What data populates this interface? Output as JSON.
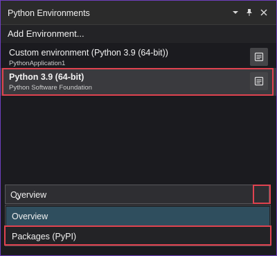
{
  "window": {
    "title": "Python Environments"
  },
  "toolbar": {
    "add_environment": "Add Environment..."
  },
  "environments": [
    {
      "name": "Custom environment (Python 3.9 (64-bit))",
      "subtitle": "PythonApplication1",
      "selected": false
    },
    {
      "name": "Python 3.9 (64-bit)",
      "subtitle": "Python Software Foundation",
      "selected": true
    }
  ],
  "view_selector": {
    "value": "Overview",
    "options": [
      "Overview",
      "Packages (PyPI)"
    ]
  },
  "colors": {
    "highlight": "#e04350",
    "accent_border": "#6f3fbf",
    "selected_option": "#2f4e5e"
  },
  "icons": [
    "dropdown-icon",
    "pin-icon",
    "close-icon",
    "environment-details-icon",
    "chevron-down-icon"
  ]
}
